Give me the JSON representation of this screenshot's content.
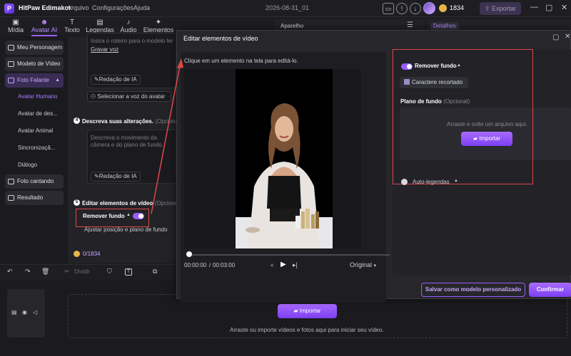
{
  "titlebar": {
    "app_name": "HitPaw Edimakor",
    "menu": [
      "Arquivo",
      "Configurações",
      "Ajuda"
    ],
    "doc_name": "2026-08-31_01",
    "credits": "1834",
    "export_label": "Exportar"
  },
  "toolbar": {
    "tools": [
      {
        "label": "Mídia",
        "icon": "media-icon"
      },
      {
        "label": "Avatar AI",
        "icon": "avatar-ai-icon"
      },
      {
        "label": "Texto",
        "icon": "text-icon"
      },
      {
        "label": "Legendas",
        "icon": "captions-icon"
      },
      {
        "label": "Áudio",
        "icon": "audio-icon"
      },
      {
        "label": "Elementos",
        "icon": "elements-icon"
      }
    ],
    "active_index": 1
  },
  "sidebar": {
    "items": [
      {
        "label": "Meu Personagem"
      },
      {
        "label": "Modelo de Vídeo"
      },
      {
        "label": "Foto Falante"
      },
      {
        "label": "Foto cantando"
      },
      {
        "label": "Resultado"
      }
    ],
    "sub_items": [
      {
        "label": "Avatar Humano"
      },
      {
        "label": "Avatar de des..."
      },
      {
        "label": "Avatar Animal"
      },
      {
        "label": "Sincronizaçã..."
      },
      {
        "label": "Diálogo"
      }
    ]
  },
  "midpanel": {
    "script_text": "Insira o roteiro para o modelo ler",
    "script_link": "Gravar voz",
    "ai_writing_label": "Redação de IA",
    "select_voice_label": "Selecionar a voz do avatar",
    "step4_number": "4",
    "step4_title": "Descreva suas alterações.",
    "step4_optional": "(Opcional)",
    "step4_placeholder": "Descreva o movimento da câmera e do plano de fundo.",
    "step5_number": "5",
    "step5_title": "Editar elementos de vídeo",
    "step5_optional": "(Opcional)",
    "remove_bg_label": "Remover fundo",
    "adjust_label": "Ajustar posição e plano de fundo",
    "credit_cost": "0/1834"
  },
  "panels": {
    "aparelho_label": "Aparelho",
    "detalhes_label": "Detalhes"
  },
  "dialog": {
    "title": "Editar elementos de vídeo",
    "hint": "Clique em um elemento na tela para editá-lo.",
    "time_current": "00:00:00",
    "time_total": "00:03:00",
    "size_label": "Original",
    "remove_bg_label": "Remover fundo",
    "cutout_label": "Caractere recortado",
    "bg_title": "Plano de fundo",
    "bg_optional": "(Opcional)",
    "drop_text": "Arraste e solte um arquivo aqui.",
    "import_label": "Importar",
    "auto_captions_label": "Auto-legendas",
    "save_template_label": "Salvar como modelo personalizado",
    "confirm_label": "Confirmar"
  },
  "timeline": {
    "split_label": "Dividir",
    "import_label": "Importar",
    "hint": "Arraste ou importe vídeos e fotos aqui para iniciar seu vídeo."
  },
  "colors": {
    "accent": "#9b5cff",
    "highlight": "#e04848"
  }
}
